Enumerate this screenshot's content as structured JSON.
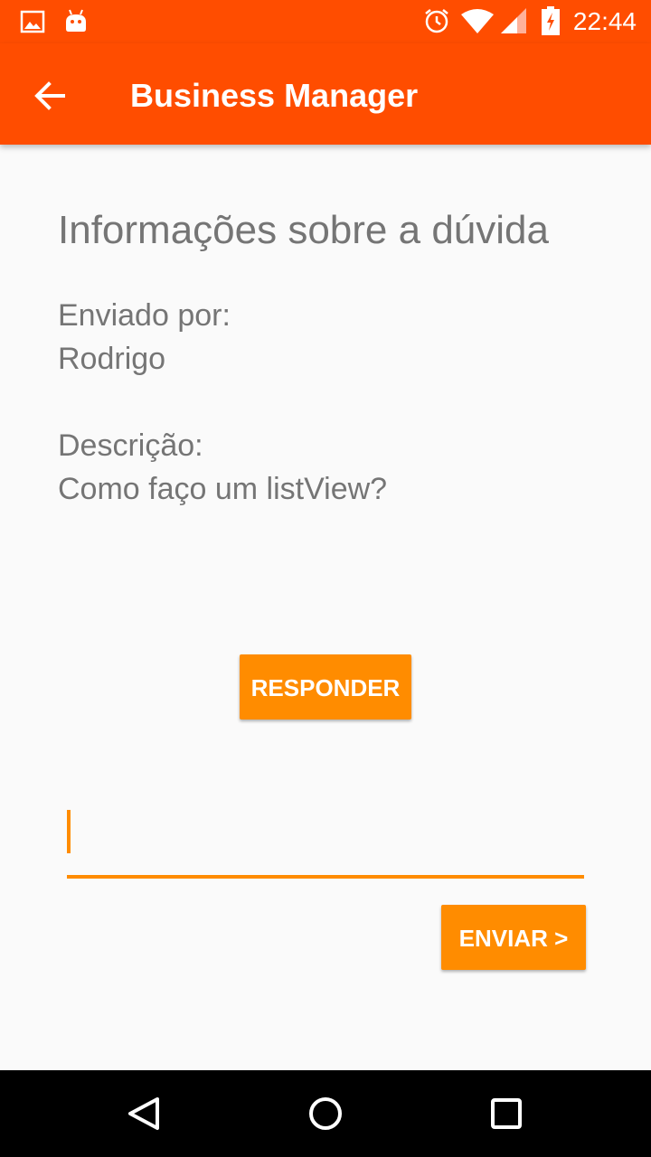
{
  "status_bar": {
    "time": "22:44",
    "icons": [
      "image-icon",
      "android-icon",
      "alarm-icon",
      "wifi-icon",
      "signal-icon",
      "battery-charging-icon"
    ]
  },
  "app_bar": {
    "title": "Business Manager",
    "back_icon": "arrow-left-icon"
  },
  "main": {
    "heading": "Informações sobre a dúvida",
    "sent_by_label": "Enviado por:",
    "sent_by_value": "Rodrigo",
    "description_label": "Descrição:",
    "description_value": "Como faço um listView?",
    "reply_button": "RESPONDER",
    "answer_input": {
      "value": "",
      "placeholder": ""
    },
    "send_button": "ENVIAR >"
  },
  "nav_bar": {
    "icons": [
      "back-triangle-icon",
      "home-circle-icon",
      "recents-square-icon"
    ]
  },
  "colors": {
    "primary": "#ff4d00",
    "accent": "#ff8c00",
    "text": "#757575",
    "background": "#fafafa"
  }
}
